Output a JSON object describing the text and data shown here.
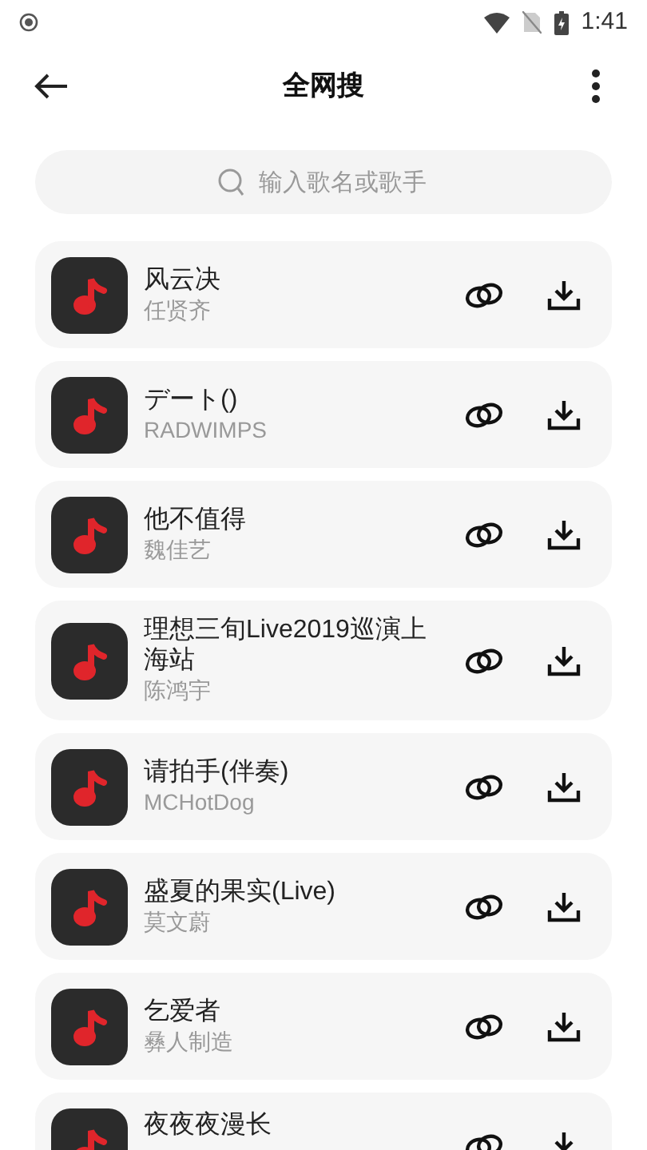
{
  "status_bar": {
    "time": "1:41"
  },
  "header": {
    "title": "全网搜"
  },
  "search": {
    "placeholder": "输入歌名或歌手"
  },
  "songs": [
    {
      "title": "风云决",
      "artist": "任贤齐"
    },
    {
      "title": "デート()",
      "artist": "RADWIMPS"
    },
    {
      "title": "他不值得",
      "artist": "魏佳艺"
    },
    {
      "title": "理想三旬Live2019巡演上海站",
      "artist": "陈鸿宇"
    },
    {
      "title": "请拍手(伴奏)",
      "artist": "MCHotDog"
    },
    {
      "title": "盛夏的果实(Live)",
      "artist": "莫文蔚"
    },
    {
      "title": "乞爱者",
      "artist": "彝人制造"
    },
    {
      "title": "夜夜夜漫长"
    }
  ]
}
